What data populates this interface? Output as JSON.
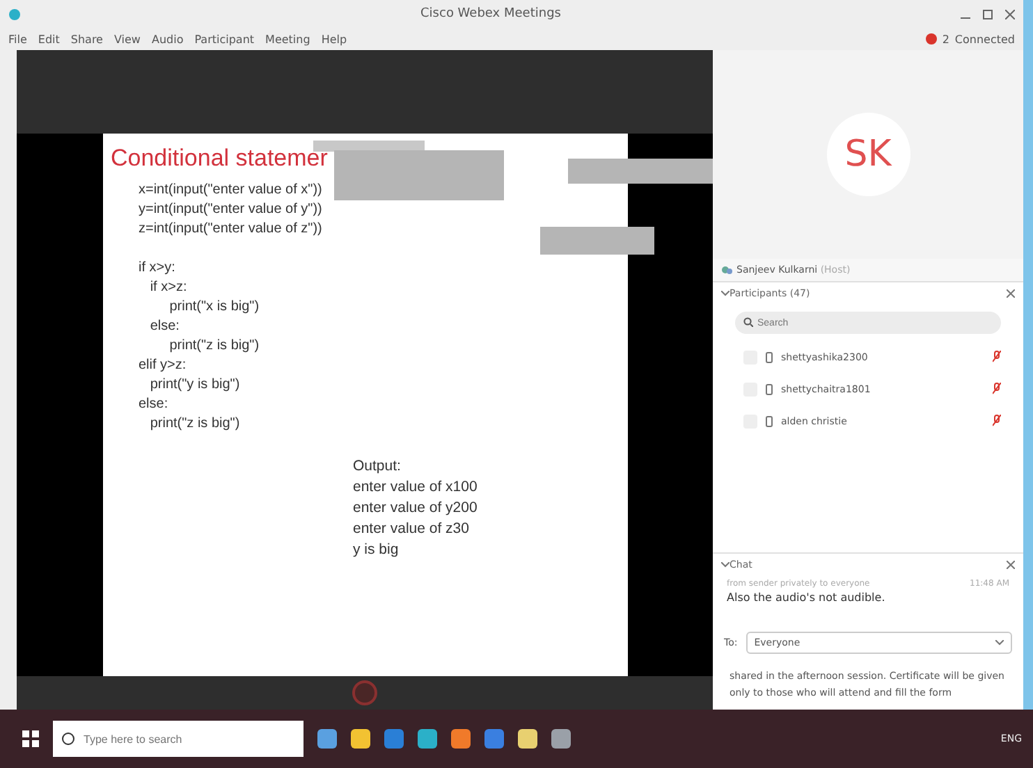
{
  "window": {
    "title": "Cisco Webex Meetings"
  },
  "menu": [
    "File",
    "Edit",
    "Share",
    "View",
    "Audio",
    "Participant",
    "Meeting",
    "Help"
  ],
  "connection": {
    "count": "2",
    "status": "Connected"
  },
  "slide": {
    "title": "Conditional statemer",
    "code": [
      [
        "x=int(input(\"enter value of x\"))",
        "y=int(input(\"enter value of y\"))",
        "z=int(input(\"enter value of z\"))"
      ],
      [
        "if x>y:",
        "   if x>z:",
        "        print(\"x is big\")",
        "   else:",
        "        print(\"z is big\")",
        "elif y>z:",
        "   print(\"y is big\")",
        "else:",
        "   print(\"z is big\")"
      ]
    ],
    "output": [
      "Output:",
      "enter value of x100",
      "enter value of y200",
      "enter value of z30",
      "y is big"
    ]
  },
  "presenter": {
    "initials": "SK",
    "name": "Sanjeev Kulkarni",
    "role": "(Host)"
  },
  "participants": {
    "title": "Participants (47)",
    "search": {
      "placeholder": "Search"
    },
    "items": [
      {
        "name": "shettyashika2300",
        "muted": true
      },
      {
        "name": "shettychaitra1801",
        "muted": true
      },
      {
        "name": "alden christie",
        "muted": true
      }
    ]
  },
  "chat": {
    "title": "Chat",
    "sender": "from sender privately to everyone",
    "time": "11:48 AM",
    "message": "Also the audio's not audible.",
    "to_label": "To:",
    "recipient": "Everyone",
    "draft": "shared in the afternoon session. Certificate will be given only to those who will attend and fill the form"
  },
  "taskbar": {
    "search": {
      "placeholder": "Type here to search"
    },
    "language": "ENG"
  }
}
